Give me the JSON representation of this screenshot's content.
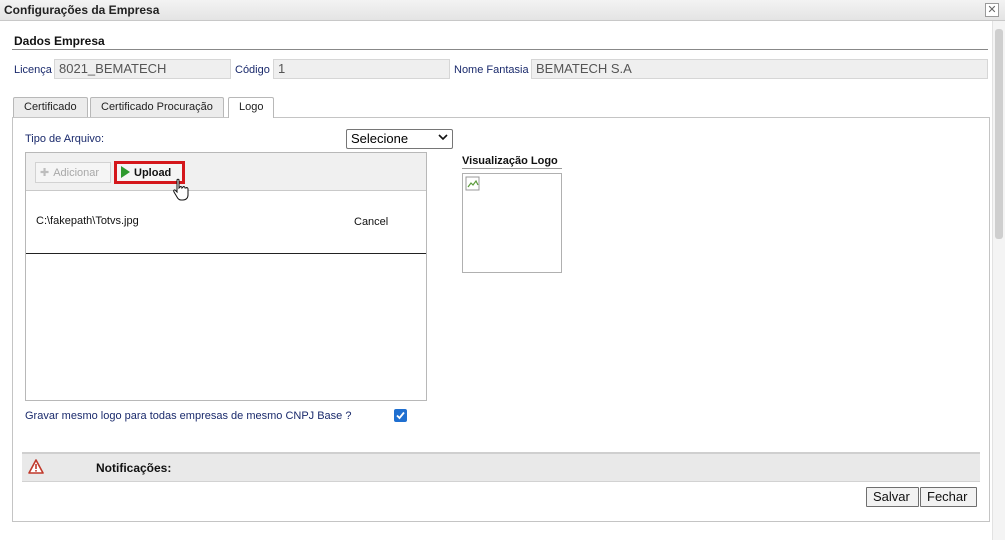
{
  "window": {
    "title": "Configurações da Empresa",
    "close_symbol": "✕"
  },
  "company": {
    "section_title": "Dados Empresa",
    "license_label": "Licença",
    "license_value": "8021_BEMATECH",
    "code_label": "Código",
    "code_value": "1",
    "trade_name_label": "Nome Fantasia",
    "trade_name_value": "BEMATECH S.A"
  },
  "tabs": [
    {
      "label": "Certificado",
      "active": false
    },
    {
      "label": "Certificado Procuração",
      "active": false
    },
    {
      "label": "Logo",
      "active": true
    }
  ],
  "logo": {
    "file_type_label": "Tipo de Arquivo:",
    "file_type_selected": "Selecione",
    "add_label": "Adicionar",
    "upload_label": "Upload",
    "file_path": "C:\\fakepath\\Totvs.jpg",
    "cancel_label": "Cancel",
    "preview_title": "Visualização Logo",
    "same_logo_label": "Gravar mesmo logo para todas empresas de mesmo CNPJ Base ?",
    "same_logo_checked": true
  },
  "notifications": {
    "label": "Notificações:"
  },
  "footer": {
    "save_label": "Salvar",
    "close_label": "Fechar"
  },
  "colors": {
    "highlight": "#d4171b",
    "checkbox": "#1f6fd0",
    "label_text": "#1a2a6c"
  },
  "icons": [
    "close-icon",
    "plus-icon",
    "play-icon",
    "hand-cursor-icon",
    "broken-image-icon",
    "checkmark-icon",
    "warning-icon",
    "chevron-down-icon"
  ]
}
